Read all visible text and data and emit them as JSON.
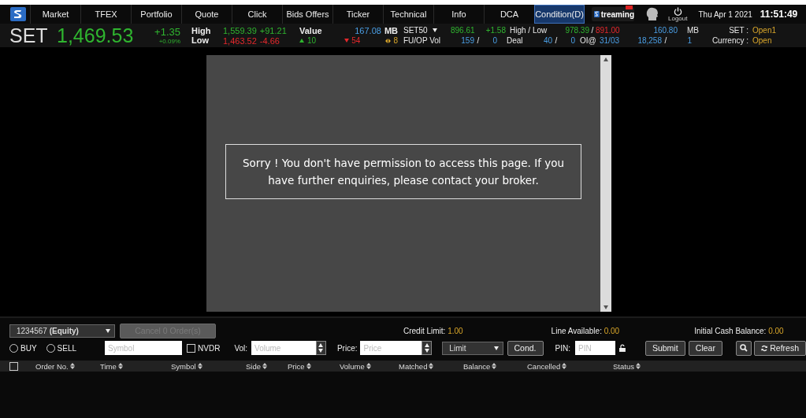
{
  "nav": {
    "items": [
      {
        "label": "Market",
        "selected": false
      },
      {
        "label": "TFEX",
        "selected": false
      },
      {
        "label": "Portfolio",
        "selected": false
      },
      {
        "label": "Quote",
        "selected": false
      },
      {
        "label": "Click",
        "selected": false
      },
      {
        "label": "Bids Offers",
        "selected": false
      },
      {
        "label": "Ticker",
        "selected": false
      },
      {
        "label": "Technical",
        "selected": false
      },
      {
        "label": "Info",
        "selected": false
      },
      {
        "label": "DCA",
        "selected": false
      },
      {
        "label": "Condition(D)",
        "selected": true
      }
    ],
    "streaming_logo": "treaming",
    "logout": "Logout",
    "date": "Thu Apr 1 2021",
    "time": "11:51:49"
  },
  "ticker": {
    "index_name": "SET",
    "index_value": "1,469.53",
    "change": "+1.35",
    "change_percent": "+0.09%",
    "high_label": "High",
    "high": "1,559.39",
    "high_change": "+91.21",
    "low_label": "Low",
    "low": "1,463.52",
    "low_change": "-4.66",
    "value_label": "Value",
    "value": "167.08",
    "value_unit": "MB",
    "advances": "10",
    "declines": "54",
    "unchanged": "8",
    "market_selector": "SET50",
    "row_1": [
      {
        "text": "896.61",
        "kind": "up"
      },
      {
        "text": "+1.58",
        "kind": "up"
      },
      {
        "text": "High / Low",
        "kind": "label"
      },
      {
        "text": "978.39",
        "kind": "up"
      },
      {
        "text": "/",
        "kind": "label"
      },
      {
        "text": "891.00",
        "kind": "down"
      },
      {
        "text": "160.80",
        "kind": "info"
      },
      {
        "text": "MB",
        "kind": "label"
      },
      {
        "text": "SET :",
        "kind": "label"
      },
      {
        "text": "Open1",
        "kind": "status"
      }
    ],
    "row_2": [
      {
        "text": "FU/OP Vol",
        "kind": "label"
      },
      {
        "text": "159",
        "kind": "info"
      },
      {
        "text": "/",
        "kind": "label"
      },
      {
        "text": "0",
        "kind": "info"
      },
      {
        "text": "Deal",
        "kind": "label"
      },
      {
        "text": "40",
        "kind": "info"
      },
      {
        "text": "/",
        "kind": "label"
      },
      {
        "text": "0",
        "kind": "info"
      },
      {
        "text": "OI@",
        "kind": "label"
      },
      {
        "text": "31/03",
        "kind": "info"
      },
      {
        "text": "18,258",
        "kind": "info"
      },
      {
        "text": "/",
        "kind": "label"
      },
      {
        "text": "1",
        "kind": "info"
      },
      {
        "text": "Currency :",
        "kind": "label"
      },
      {
        "text": "Open",
        "kind": "status"
      }
    ]
  },
  "message": "Sorry ! You don't have permission to access this page. If you have further enquiries, please contact your broker.",
  "order_panel": {
    "account": "1234567 **(Equity)**",
    "cancel_button": {
      "label": "Cancel 0 Order(s)",
      "disabled": true
    },
    "credit_limit": {
      "label": "Credit Limit:",
      "value": "1.00"
    },
    "line_available": {
      "label": "Line Available:",
      "value": "0.00"
    },
    "initial_cash": {
      "label": "Initial Cash Balance:",
      "value": "0.00"
    },
    "sides": [
      {
        "label": "BUY",
        "selected": false
      },
      {
        "label": "SELL",
        "selected": false
      }
    ],
    "symbol": {
      "placeholder": "Symbol"
    },
    "nvdr": {
      "label": "NVDR",
      "checked": false
    },
    "volume": {
      "label": "Vol:",
      "placeholder": "Volume"
    },
    "price": {
      "label": "Price:",
      "placeholder": "Price"
    },
    "order_type": "Limit",
    "cond_button": "Cond.",
    "pin": {
      "label": "PIN:",
      "placeholder": "PIN"
    },
    "submit_button": "Submit",
    "clear_button": "Clear",
    "refresh_button": "Refresh"
  },
  "table": {
    "select_all": false,
    "columns": [
      "Order No.",
      "Time",
      "Symbol",
      "Side",
      "Price",
      "Volume",
      "Matched",
      "Balance",
      "Cancelled",
      "Status"
    ]
  }
}
